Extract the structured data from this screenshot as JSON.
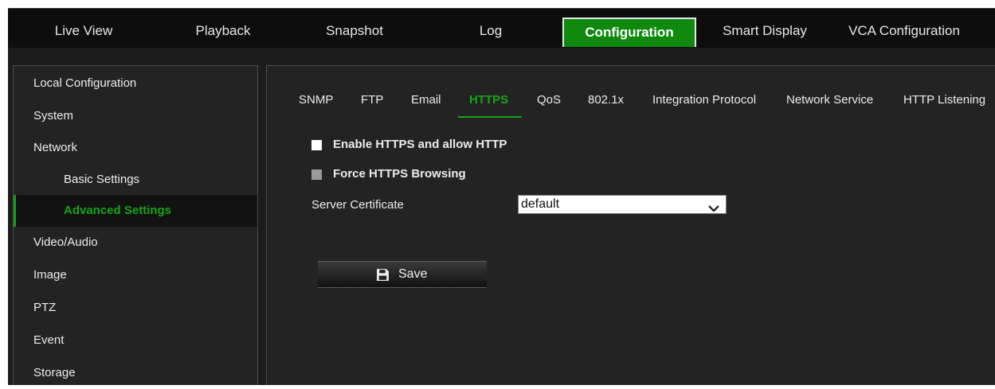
{
  "top_nav": {
    "tabs": [
      {
        "label": "Live View"
      },
      {
        "label": "Playback"
      },
      {
        "label": "Snapshot"
      },
      {
        "label": "Log"
      },
      {
        "label": "Configuration",
        "active": true
      },
      {
        "label": "Smart Display"
      },
      {
        "label": "VCA Configuration"
      }
    ]
  },
  "sidebar": {
    "items": [
      {
        "label": "Local Configuration"
      },
      {
        "label": "System"
      },
      {
        "label": "Network"
      },
      {
        "label": "Basic Settings",
        "sub": true
      },
      {
        "label": "Advanced Settings",
        "sub": true,
        "active": true
      },
      {
        "label": "Video/Audio"
      },
      {
        "label": "Image"
      },
      {
        "label": "PTZ"
      },
      {
        "label": "Event"
      },
      {
        "label": "Storage"
      }
    ]
  },
  "subtabs": {
    "items": [
      {
        "label": "SNMP"
      },
      {
        "label": "FTP"
      },
      {
        "label": "Email"
      },
      {
        "label": "HTTPS",
        "active": true
      },
      {
        "label": "QoS"
      },
      {
        "label": "802.1x"
      },
      {
        "label": "Integration Protocol"
      },
      {
        "label": "Network Service"
      },
      {
        "label": "HTTP Listening"
      }
    ]
  },
  "form": {
    "enable_https_label": "Enable HTTPS and allow HTTP",
    "enable_https_checked": false,
    "force_https_label": "Force HTTPS Browsing",
    "force_https_checked": false,
    "force_https_disabled": true,
    "server_certificate_label": "Server Certificate",
    "server_certificate_value": "default",
    "save_label": "Save"
  },
  "colors": {
    "accent_green": "#17a417",
    "active_tab_bg": "#0f8a0f",
    "panel_bg": "#232323",
    "nav_bg": "#0d0d0d"
  },
  "icons": {
    "save": "floppy-disk-icon",
    "select_arrow": "chevron-down-icon"
  }
}
